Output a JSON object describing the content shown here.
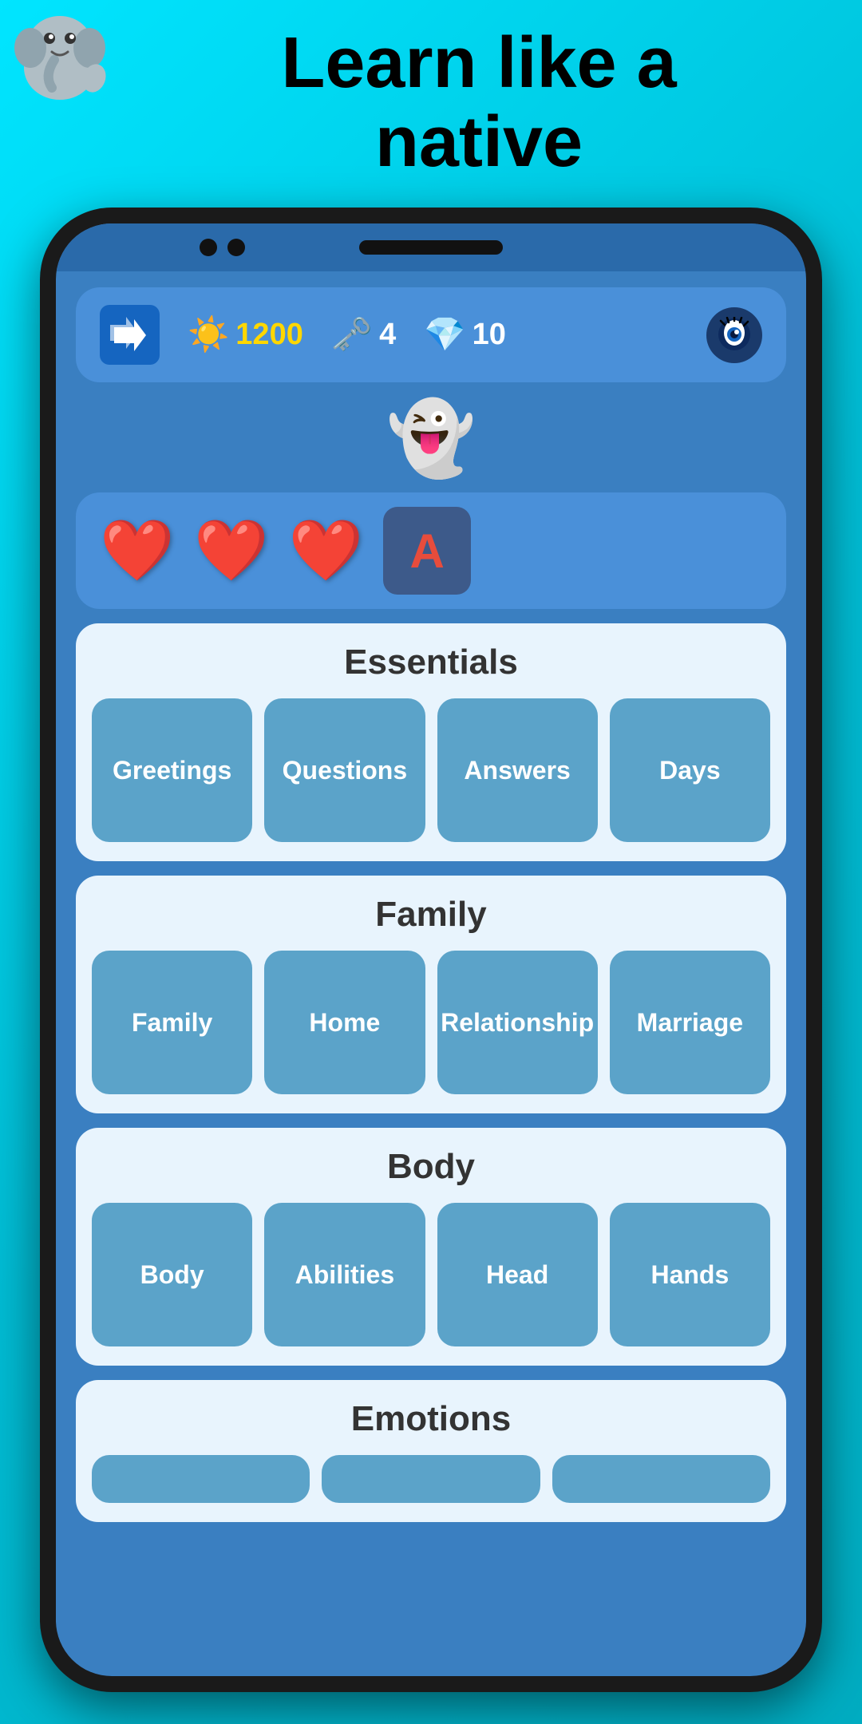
{
  "headline": {
    "line1": "Learn like a",
    "line2": "native"
  },
  "stats": {
    "stars": "1200",
    "keys": "4",
    "gems": "10",
    "star_icon": "☀️",
    "key_icon": "🗝️",
    "gem_icon": "💎"
  },
  "hearts": {
    "count": 3,
    "letter": "A"
  },
  "sections": [
    {
      "title": "Essentials",
      "tiles": [
        "Greetings",
        "Questions",
        "Answers",
        "Days"
      ]
    },
    {
      "title": "Family",
      "tiles": [
        "Family",
        "Home",
        "Relationship",
        "Marriage"
      ]
    },
    {
      "title": "Body",
      "tiles": [
        "Body",
        "Abilities",
        "Head",
        "Hands"
      ]
    },
    {
      "title": "Emotions",
      "tiles": []
    }
  ]
}
